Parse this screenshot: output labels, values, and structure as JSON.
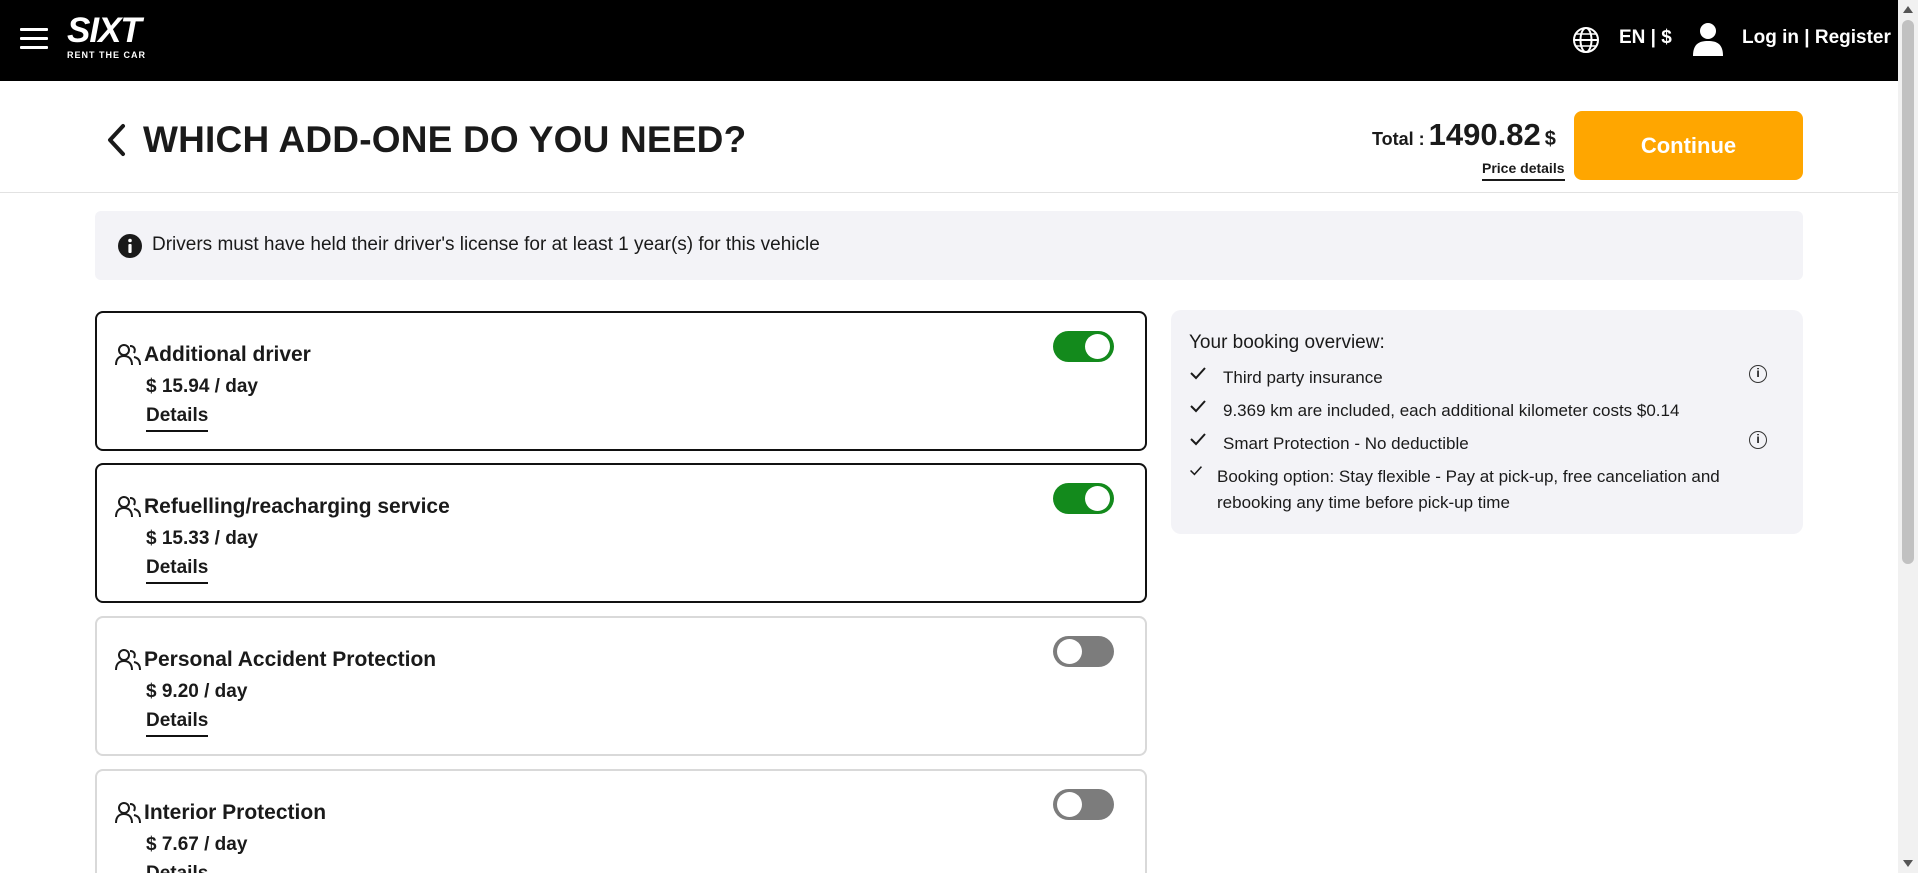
{
  "nav": {
    "logo_text": "SIXT",
    "logo_tagline": "RENT THE CAR",
    "language_currency": "EN | $",
    "login_register": "Log in | Register"
  },
  "header": {
    "title": "WHICH ADD-ONE DO YOU NEED?",
    "total_label": "Total :",
    "total_value": "1490.82",
    "total_currency": "$",
    "price_details": "Price details",
    "continue_label": "Continue"
  },
  "notice": {
    "text": "Drivers must have held their driver's license for at least 1 year(s) for this vehicle"
  },
  "addons": [
    {
      "name": "Additional driver",
      "price": "$ 15.94 / day",
      "details": "Details",
      "enabled": true
    },
    {
      "name": "Refuelling/reacharging service",
      "price": "$ 15.33 / day",
      "details": "Details",
      "enabled": true
    },
    {
      "name": "Personal Accident Protection",
      "price": "$ 9.20 / day",
      "details": "Details",
      "enabled": false
    },
    {
      "name": "Interior Protection",
      "price": "$ 7.67 / day",
      "details": "Details",
      "enabled": false
    }
  ],
  "overview": {
    "title": "Your booking overview:",
    "items": [
      {
        "text": "Third party insurance",
        "has_info": true
      },
      {
        "text": "9.369 km are included, each additional kilometer costs $0.14",
        "has_info": false
      },
      {
        "text": "Smart Protection - No deductible",
        "has_info": true
      },
      {
        "text_line1": "Booking option: Stay flexible - Pay at pick-up, free canceliation and",
        "text_line2": "rebooking any time before pick-up time",
        "has_info": false
      }
    ]
  },
  "colors": {
    "accent": "#ffa600",
    "toggle_on": "#138a1c",
    "toggle_off": "#7c7c7c",
    "topbar": "#000000"
  }
}
